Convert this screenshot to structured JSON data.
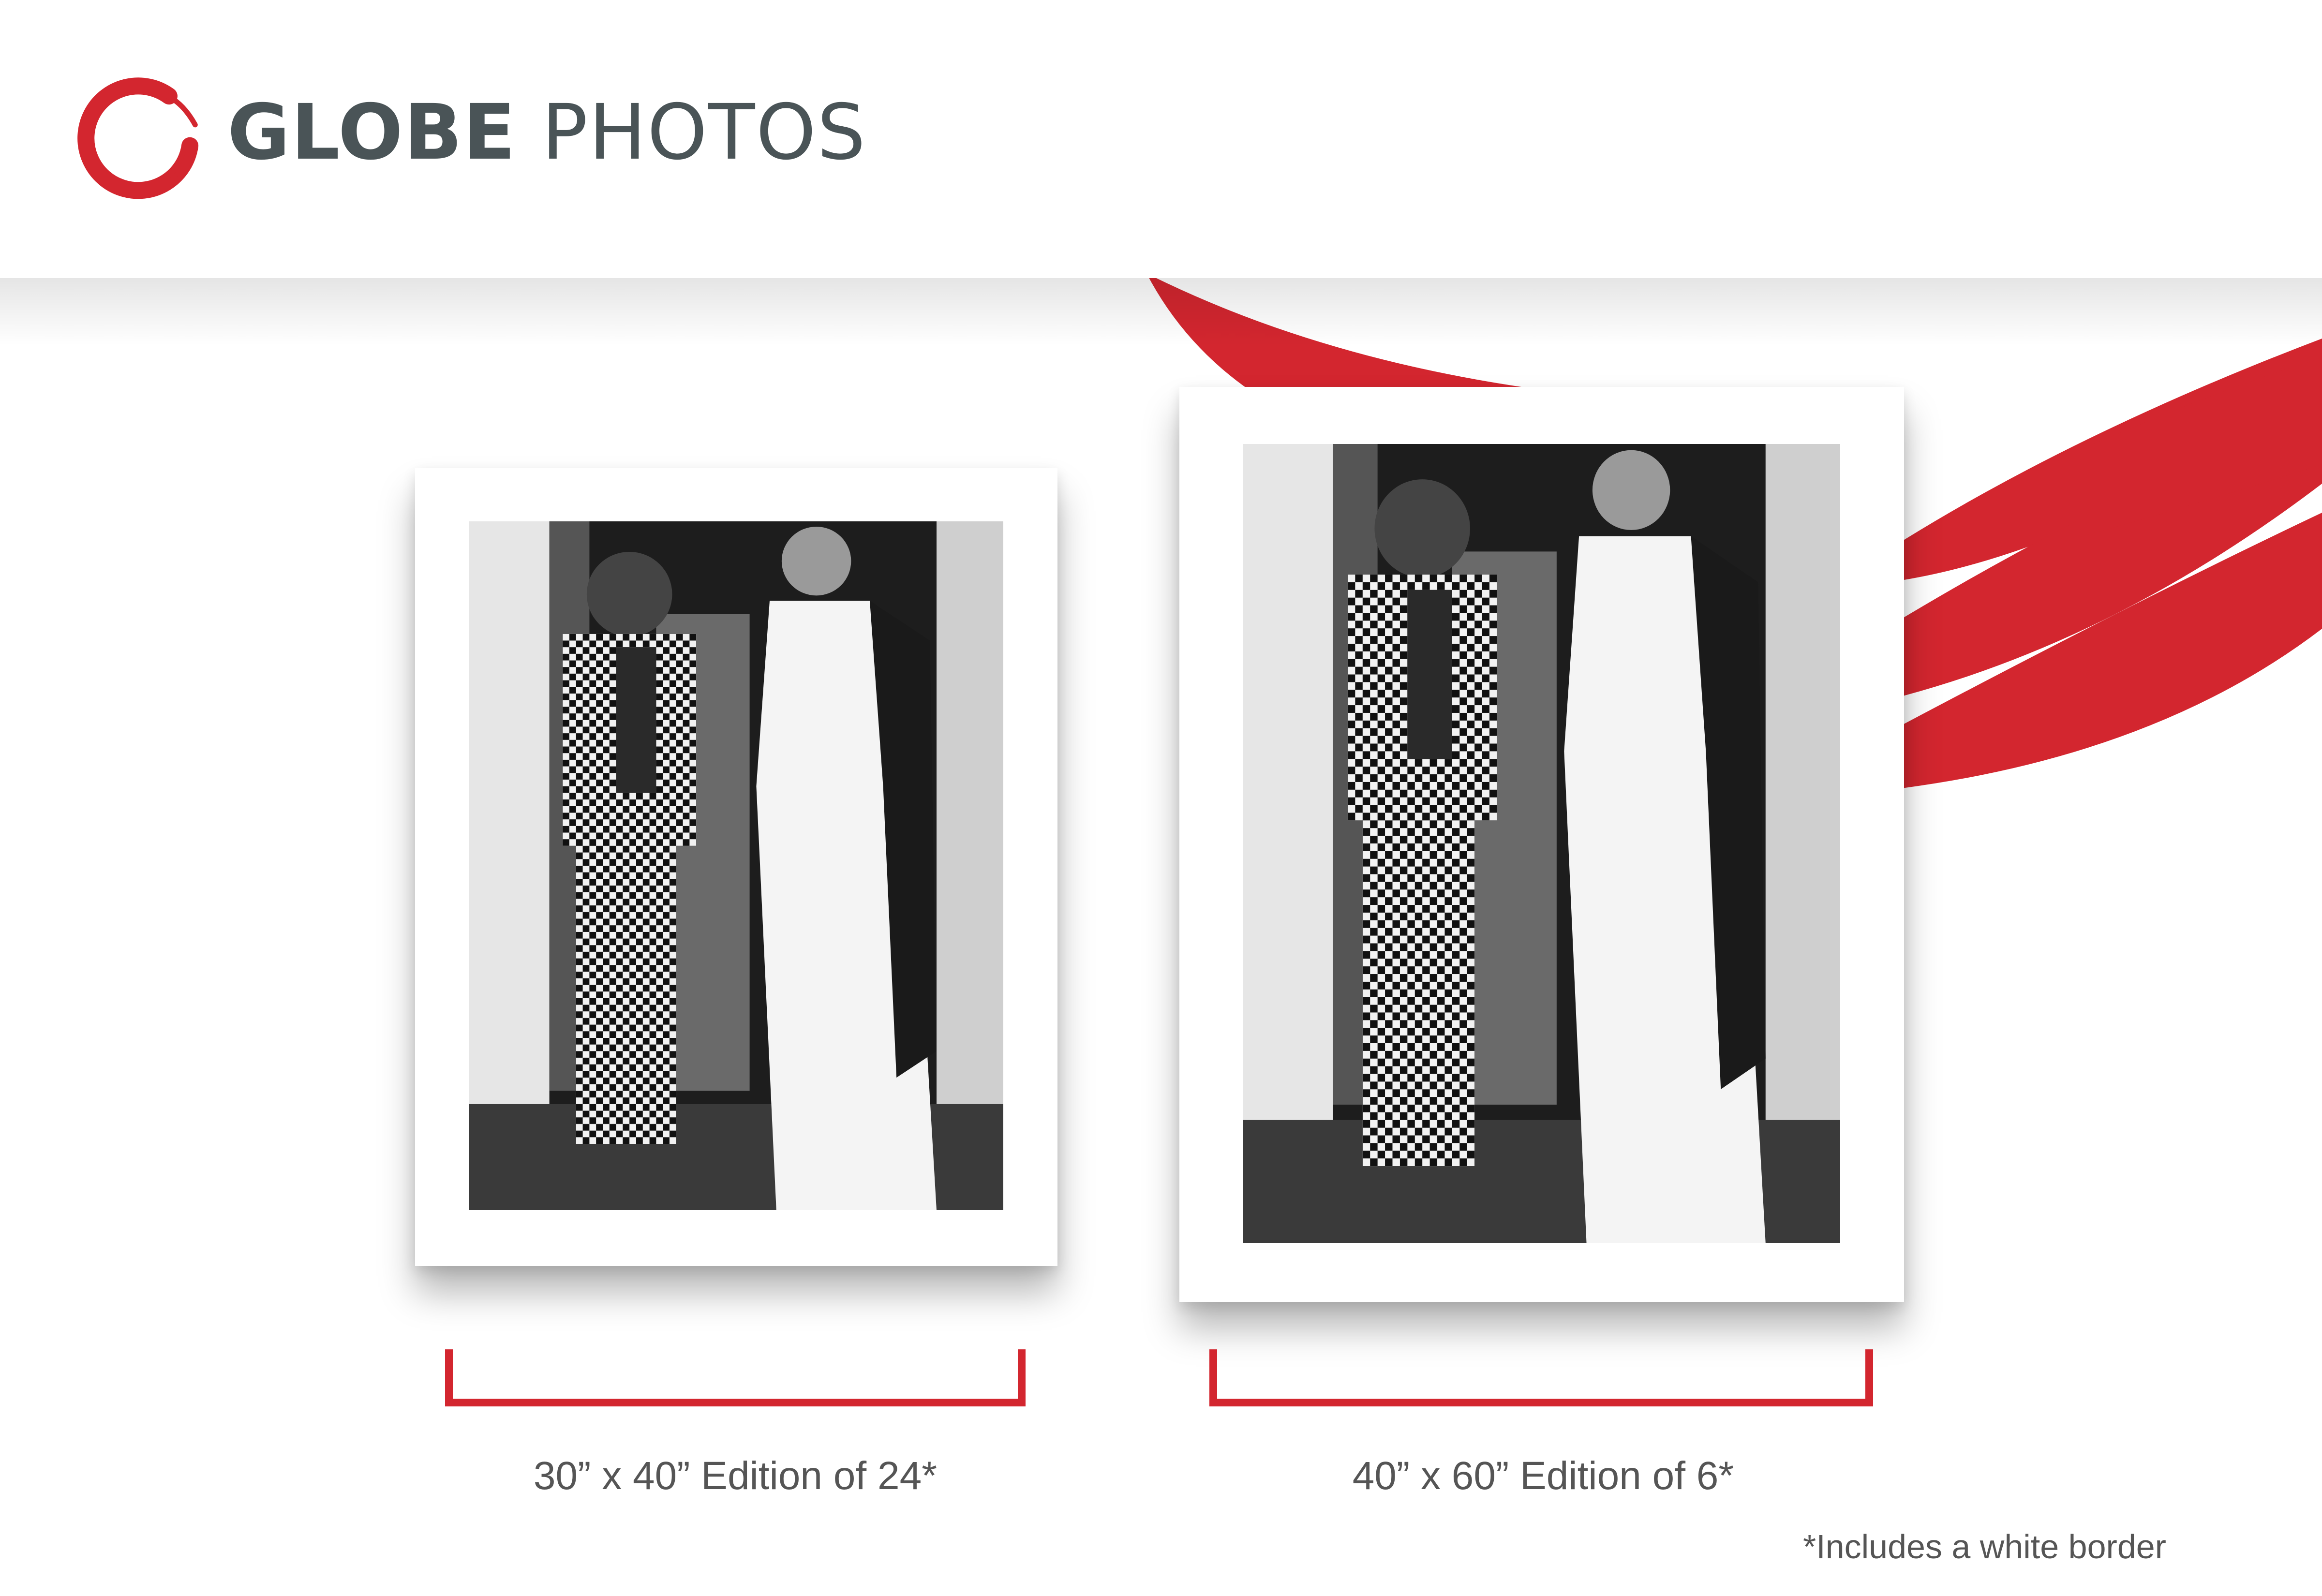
{
  "brand": {
    "name_bold": "GLOBE",
    "name_light": "PHOTOS",
    "logo_icon": "brush-circle-logo",
    "accent_color": "#d3262f",
    "text_color": "#4a5457"
  },
  "prints": [
    {
      "size_label": "30” x 40” Edition of 24*",
      "photo_icon": "black-and-white-photograph"
    },
    {
      "size_label": "40” x 60” Edition of 6*",
      "photo_icon": "black-and-white-photograph"
    }
  ],
  "footnote": "*Includes a white border"
}
